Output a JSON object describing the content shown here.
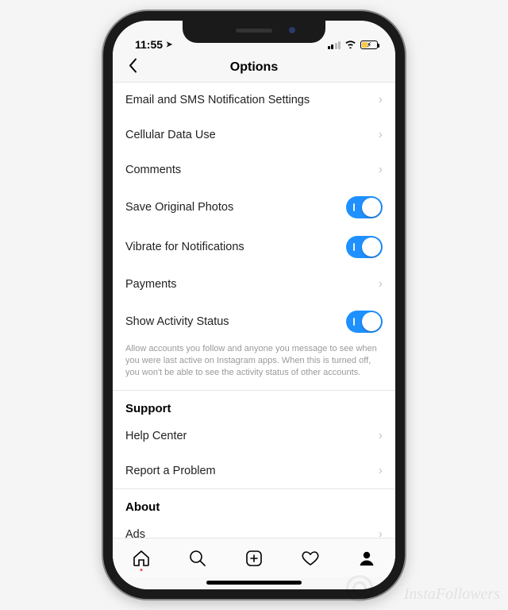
{
  "status": {
    "time": "11:55"
  },
  "header": {
    "title": "Options"
  },
  "rows": {
    "email_sms": "Email and SMS Notification Settings",
    "cellular": "Cellular Data Use",
    "comments": "Comments",
    "save_photos": "Save Original Photos",
    "vibrate": "Vibrate for Notifications",
    "payments": "Payments",
    "activity_status": "Show Activity Status"
  },
  "toggles": {
    "save_photos": true,
    "vibrate": true,
    "activity_status": true
  },
  "footnote": "Allow accounts you follow and anyone you message to see when you were last active on Instagram apps. When this is turned off, you won't be able to see the activity status of other accounts.",
  "sections": {
    "support": "Support",
    "about": "About"
  },
  "support": {
    "help_center": "Help Center",
    "report_problem": "Report a Problem"
  },
  "about": {
    "ads": "Ads"
  },
  "watermark": "InstaFollowers"
}
